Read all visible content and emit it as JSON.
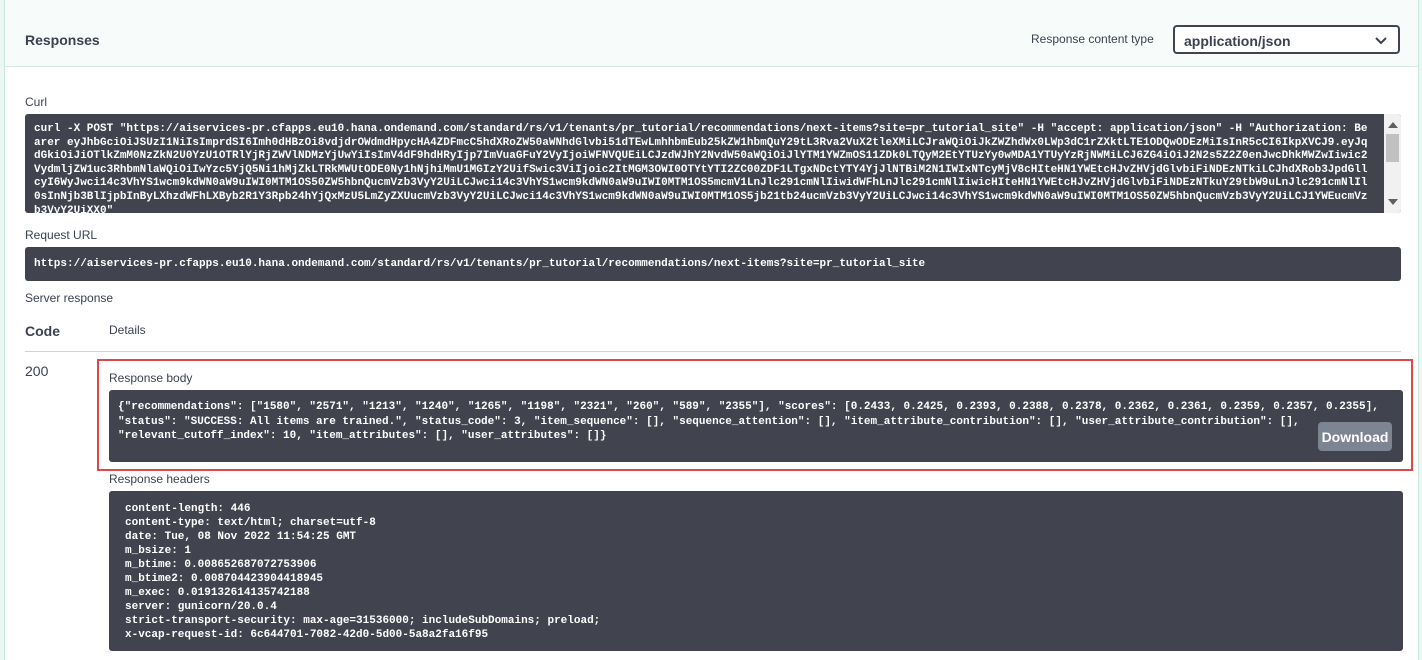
{
  "responses": {
    "title": "Responses",
    "content_type_label": "Response content type",
    "content_type_value": "application/json"
  },
  "curl": {
    "label": "Curl",
    "text": "curl -X POST \"https://aiservices-pr.cfapps.eu10.hana.ondemand.com/standard/rs/v1/tenants/pr_tutorial/recommendations/next-items?site=pr_tutorial_site\" -H \"accept: application/json\" -H \"Authorization: Bearer eyJhbGciOiJSUzI1NiIsImprdSI6Imh0dHBzOi8vdjdrOWdmdHpycHA4ZDFmcC5hdXRoZW50aWNhdGlvbi51dTEwLmhhbmEub25kZW1hbmQuY29tL3Rva2VuX2tleXMiLCJraWQiOiJkZWZhdWx0LWp3dC1rZXktLTE1ODQwODEzMiIsInR5cCI6IkpXVCJ9.eyJqdGkiOiJiOTlkZmM0NzZkN2U0YzU1OTRlYjRjZWVlNDMzYjUwYiIsImV4dF9hdHRyIjp7ImVuaGFuY2VyIjoiWFNVQUEiLCJzdWJhY2NvdW50aWQiOiJlYTM1YWZmOS11ZDk0LTQyM2EtYTUzYy0wMDA1YTUyYzRjNWMiLCJ6ZG4iOiJ2N2s5Z2Z0enJwcDhkMWZwIiwic2VydmljZW1uc3RhbmNlaWQiOiIwYzc5YjQ5Ni1hMjZkLTRkMWUtODE0Ny1hNjhiMmU1MGIzY2UifSwic3ViIjoic2ItMGM3OWI0OTYtYTI2ZC00ZDF1LTgxNDctYTY4YjJlNTBiM2N1IWIxNTcyMjV8cHIteHN1YWEtcHJvZHVjdGlvbiFiNDEzNTkiLCJhdXRob3JpdGllcyI6WyJwci14c3VhYS1wcm9kdWN0aW9uIWI0MTM1OS50ZW5hbnQucmVzb3VyY2UiLCJwci14c3VhYS1wcm9kdWN0aW9uIWI0MTM1OS5mcmV1LnJlc291cmNlIiwidWFhLnJlc291cmNlIiwicHIteHN1YWEtcHJvZHVjdGlvbiFiNDEzNTkuY29tbW9uLnJlc291cmNlIl0sInNjb3BlIjpbInByLXhzdWFhLXByb2R1Y3Rpb24hYjQxMzU5LmZyZXUucmVzb3VyY2UiLCJwci14c3VhYS1wcm9kdWN0aW9uIWI0MTM1OS5jb21tb24ucmVzb3VyY2UiLCJwci14c3VhYS1wcm9kdWN0aW9uIWI0MTM1OS50ZW5hbnQucmVzb3VyY2UiLCJ1YWEucmVzb3VyY2UiXX0\""
  },
  "request_url": {
    "label": "Request URL",
    "value": "https://aiservices-pr.cfapps.eu10.hana.ondemand.com/standard/rs/v1/tenants/pr_tutorial/recommendations/next-items?site=pr_tutorial_site"
  },
  "server_response": {
    "label": "Server response",
    "code_header": "Code",
    "details_header": "Details",
    "code": "200",
    "body_label": "Response body",
    "body_lines": [
      "{\"recommendations\": [\"1580\", \"2571\", \"1213\", \"1240\", \"1265\", \"1198\", \"2321\", \"260\", \"589\", \"2355\"], \"scores\": [0.2433, 0.2425, 0.2393, 0.2388, 0.2378, 0.2362, 0.2361, 0.2359, 0.2357, 0.2355],",
      "\"status\": \"SUCCESS: All items are trained.\", \"status_code\": 3, \"item_sequence\": [], \"sequence_attention\": [], \"item_attribute_contribution\": [], \"user_attribute_contribution\": [],",
      "\"relevant_cutoff_index\": 10, \"item_attributes\": [], \"user_attributes\": []}"
    ],
    "download_label": "Download",
    "headers_label": "Response headers",
    "headers": [
      "content-length: 446",
      "content-type: text/html; charset=utf-8",
      "date: Tue, 08 Nov 2022 11:54:25 GMT",
      "m_bsize: 1",
      "m_btime: 0.008652687072753906",
      "m_btime2: 0.008704423904418945",
      "m_exec: 0.019132614135742188",
      "server: gunicorn/20.0.4",
      "strict-transport-security: max-age=31536000; includeSubDomains; preload;",
      "x-vcap-request-id: 6c644701-7082-42d0-5d00-5a8a2fa16f95"
    ]
  },
  "colors": {
    "highlight_border": "#e0474c",
    "code_block_bg": "#41444e",
    "download_button_bg": "#7d8492"
  },
  "icons": {
    "select_chevron": "chevron-down-icon",
    "scroll_up": "arrow-up-icon",
    "scroll_down": "arrow-down-icon"
  }
}
